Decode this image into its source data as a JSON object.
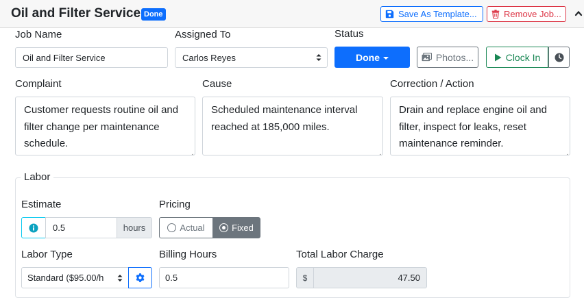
{
  "header": {
    "title": "Oil and Filter Service",
    "status_badge": "Done",
    "save_template_label": "Save As Template...",
    "remove_job_label": "Remove Job...",
    "colors": {
      "primary": "#0d6efd",
      "danger": "#dc3545",
      "success": "#198754",
      "secondary": "#6c757d"
    }
  },
  "job": {
    "name_label": "Job Name",
    "name_value": "Oil and Filter Service",
    "assigned_label": "Assigned To",
    "assigned_value": "Carlos Reyes",
    "status_label": "Status",
    "status_value": "Done",
    "photos_label": "Photos...",
    "clock_in_label": "Clock In",
    "icons": [
      "save-icon",
      "trash-icon",
      "chevron-up-icon",
      "caret-down-icon",
      "images-icon",
      "play-icon",
      "clock-icon"
    ]
  },
  "notes": {
    "complaint_label": "Complaint",
    "complaint_text": "Customer requests routine oil and filter change per maintenance schedule.",
    "cause_label": "Cause",
    "cause_text": "Scheduled maintenance interval reached at 185,000 miles.",
    "correction_label": "Correction / Action",
    "correction_text": "Drain and replace engine oil and filter, inspect for leaks, reset maintenance reminder."
  },
  "labor": {
    "legend": "Labor",
    "estimate_label": "Estimate",
    "estimate_value": "0.5",
    "estimate_unit": "hours",
    "pricing_label": "Pricing",
    "pricing_options": [
      "Actual",
      "Fixed"
    ],
    "pricing_selected": "Fixed",
    "labor_type_label": "Labor Type",
    "labor_type_value": "Standard ($95.00/h",
    "billing_hours_label": "Billing Hours",
    "billing_hours_value": "0.5",
    "total_label": "Total Labor Charge",
    "currency_symbol": "$",
    "total_value": "47.50",
    "icons": [
      "info-icon",
      "gear-icon"
    ]
  }
}
